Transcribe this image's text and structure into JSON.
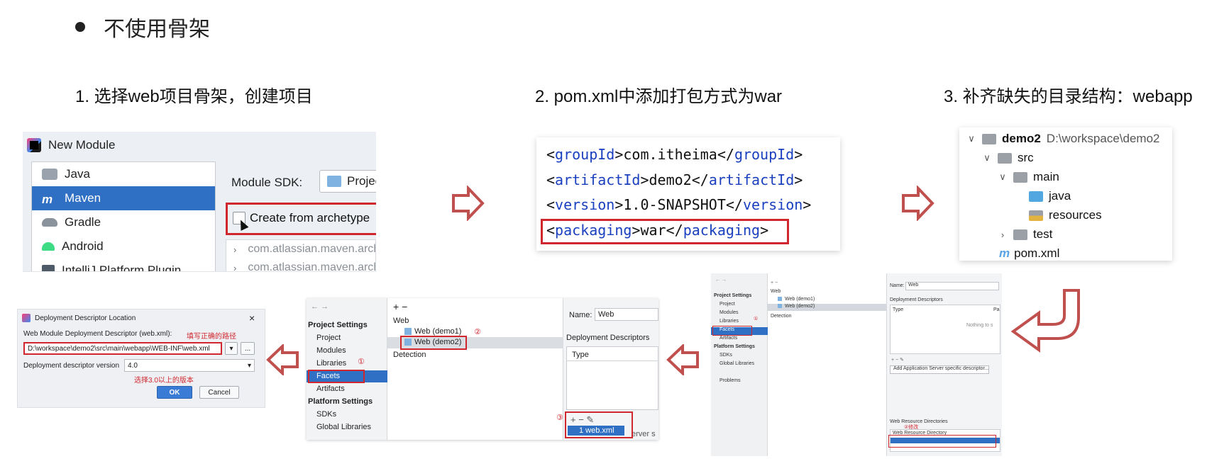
{
  "title": "不使用骨架",
  "steps": {
    "s1": "1. 选择web项目骨架，创建项目",
    "s2": "2. pom.xml中添加打包方式为war",
    "s3": "3. 补齐缺失的目录结构：webapp"
  },
  "new_module": {
    "window_title": "New Module",
    "generators": [
      "Java",
      "Maven",
      "Gradle",
      "Android",
      "IntelliJ Platform Plugin"
    ],
    "selected": "Maven",
    "sdk_label": "Module SDK:",
    "sdk_value": "Project S",
    "archetype_checkbox": "Create from archetype",
    "archetypes": [
      "com.atlassian.maven.arche",
      "com.atlassian.maven.arche"
    ]
  },
  "pom": {
    "lines": [
      {
        "tag": "groupId",
        "value": "com.itheima"
      },
      {
        "tag": "artifactId",
        "value": "demo2"
      },
      {
        "tag": "version",
        "value": "1.0-SNAPSHOT"
      },
      {
        "tag": "packaging",
        "value": "war"
      }
    ]
  },
  "tree": {
    "project": "demo2",
    "path": "D:\\workspace\\demo2",
    "src": "src",
    "main": "main",
    "java": "java",
    "resources": "resources",
    "test": "test",
    "pom": "pom.xml"
  },
  "ps_small": {
    "project_settings": "Project Settings",
    "items": [
      "Project",
      "Modules",
      "Libraries",
      "Facets",
      "Artifacts"
    ],
    "platform_settings": "Platform Settings",
    "platform_items": [
      "SDKs",
      "Global Libraries"
    ],
    "problems": "Problems",
    "web": "Web",
    "web_demo1": "Web (demo1)",
    "web_demo2": "Web (demo2)",
    "detection": "Detection",
    "name_label": "Name:",
    "name_value": "Web",
    "deployment_descriptors": "Deployment Descriptors",
    "type_col": "Type",
    "path_col": "Pa",
    "nothing": "Nothing to s",
    "add_app_server": "Add Application Server specific descriptor...",
    "web_resource_dirs": "Web Resource Directories",
    "web_resource_dir": "Web Resource Directory",
    "mark1": "①",
    "mark2": "②修改"
  },
  "ps_mid": {
    "project_settings": "Project Settings",
    "items": [
      "Project",
      "Modules",
      "Libraries",
      "Facets",
      "Artifacts"
    ],
    "platform_settings": "Platform Settings",
    "platform_items": [
      "SDKs",
      "Global Libraries"
    ],
    "web": "Web",
    "web_demo1": "Web (demo1)",
    "web_demo2": "Web (demo2)",
    "detection": "Detection",
    "name_label": "Name:",
    "name_value": "Web",
    "deployment_descriptors": "Deployment Descriptors",
    "type_col": "Type",
    "webxml": "1  web.xml",
    "server_tail": "erver s",
    "mark1": "①",
    "mark2": "②",
    "mark3": "③"
  },
  "dd": {
    "title": "Deployment Descriptor Location",
    "label": "Web Module Deployment Descriptor (web.xml):",
    "hint_path": "填写正确的路径",
    "path_value": "D:\\workspace\\demo2\\src\\main\\webapp\\WEB-INF\\web.xml",
    "version_label": "Deployment descriptor version",
    "version_value": "4.0",
    "hint_version": "选择3.0以上的版本",
    "ok": "OK",
    "cancel": "Cancel",
    "browse": "..."
  },
  "colors": {
    "accent": "#2f70c4",
    "highlight_red": "#d0262e",
    "arrow_red": "#c0504d",
    "xml_tag": "#1a3fbf"
  }
}
